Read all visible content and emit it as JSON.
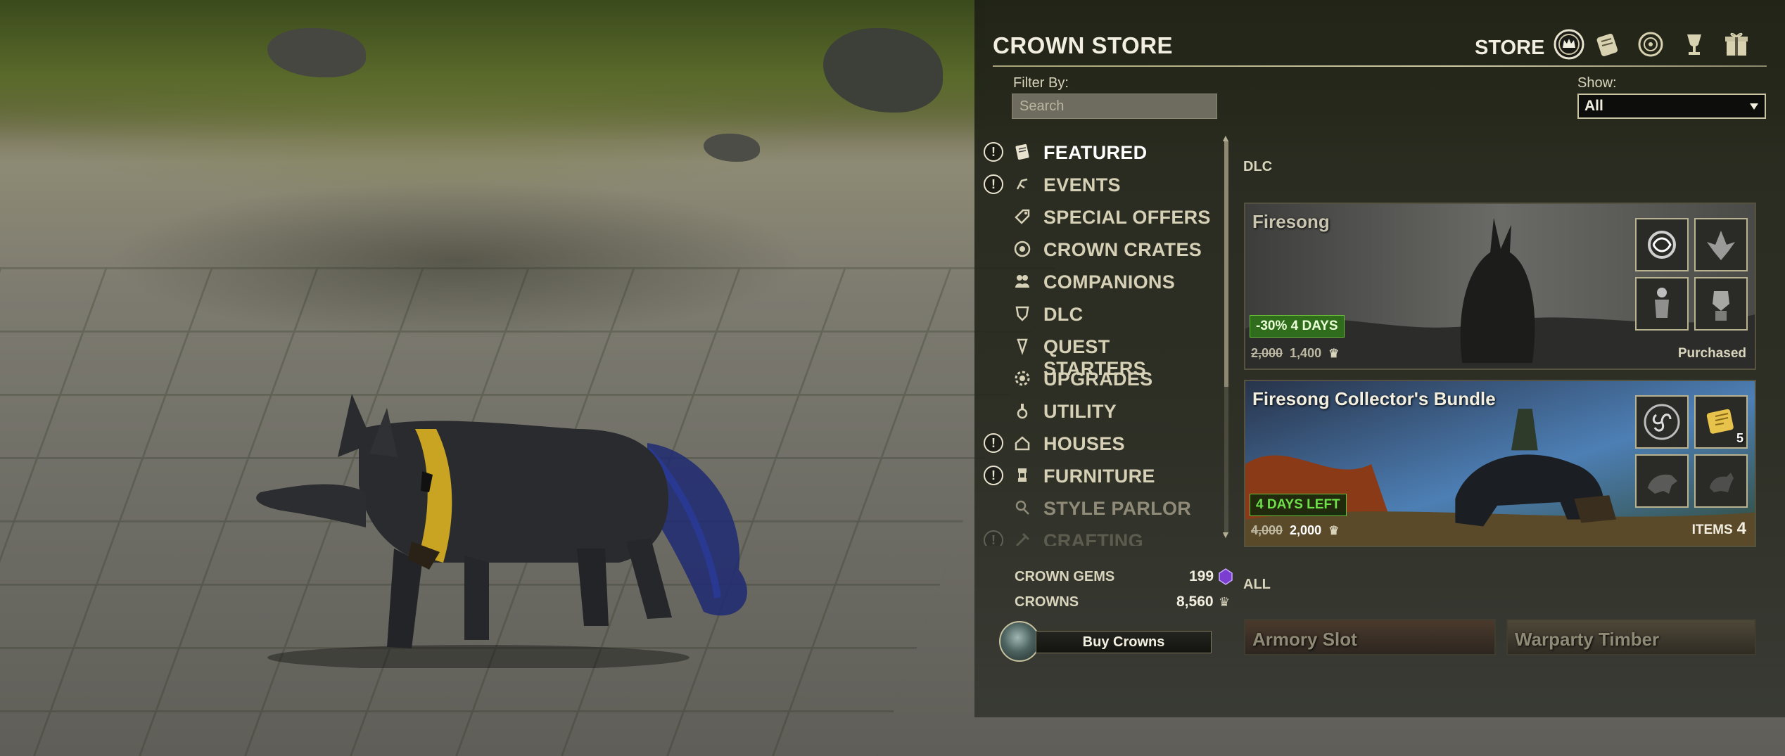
{
  "store": {
    "title": "CROWN STORE",
    "tab_label": "STORE",
    "tabs": [
      {
        "name": "store-tab",
        "icon": "crown-store-icon",
        "active": true
      },
      {
        "name": "crown-crates-tab",
        "icon": "scroll-icon"
      },
      {
        "name": "daily-rewards-tab",
        "icon": "seal-icon"
      },
      {
        "name": "endeavors-tab",
        "icon": "chalice-icon"
      },
      {
        "name": "gifts-tab",
        "icon": "gift-icon"
      }
    ]
  },
  "filter": {
    "label": "Filter By:",
    "search_placeholder": "Search",
    "show_label": "Show:",
    "show_value": "All"
  },
  "categories": [
    {
      "label": "FEATURED",
      "icon": "scroll-icon",
      "alert": true,
      "selected": true
    },
    {
      "label": "EVENTS",
      "icon": "event-icon",
      "alert": true
    },
    {
      "label": "SPECIAL OFFERS",
      "icon": "tag-icon",
      "alert": false
    },
    {
      "label": "CROWN CRATES",
      "icon": "crate-icon",
      "alert": false
    },
    {
      "label": "COMPANIONS",
      "icon": "companions-icon",
      "alert": false
    },
    {
      "label": "DLC",
      "icon": "dlc-icon",
      "alert": false
    },
    {
      "label": "QUEST STARTERS",
      "icon": "quest-icon",
      "alert": false
    },
    {
      "label": "UPGRADES",
      "icon": "upgrade-icon",
      "alert": false
    },
    {
      "label": "UTILITY",
      "icon": "potion-icon",
      "alert": false
    },
    {
      "label": "HOUSES",
      "icon": "house-icon",
      "alert": true
    },
    {
      "label": "FURNITURE",
      "icon": "furniture-icon",
      "alert": true
    },
    {
      "label": "STYLE PARLOR",
      "icon": "style-icon",
      "alert": false,
      "dim": true
    },
    {
      "label": "CRAFTING",
      "icon": "crafting-icon",
      "alert": true,
      "faded": true
    }
  ],
  "currency": {
    "gems_label": "CROWN GEMS",
    "gems_value": "199",
    "crowns_label": "CROWNS",
    "crowns_value": "8,560",
    "buy_label": "Buy Crowns"
  },
  "sections": {
    "dlc_label": "DLC",
    "all_label": "ALL"
  },
  "products": {
    "firesong": {
      "name": "Firesong",
      "badge": "-30% 4 DAYS",
      "price_old": "2,000",
      "price_new": "1,400",
      "status": "Purchased"
    },
    "bundle": {
      "name": "Firesong Collector's Bundle",
      "badge": "4 DAYS LEFT",
      "price_old": "4,000",
      "price_new": "2,000",
      "items_label": "ITEMS",
      "items_count": "4",
      "thumb_count": "5"
    },
    "armory": {
      "name": "Armory Slot"
    },
    "warparty": {
      "name": "Warparty Timber"
    }
  },
  "colors": {
    "accent": "#cfc9a4",
    "sale_green": "#2f6d1c",
    "timer_green": "#6ee04a"
  }
}
